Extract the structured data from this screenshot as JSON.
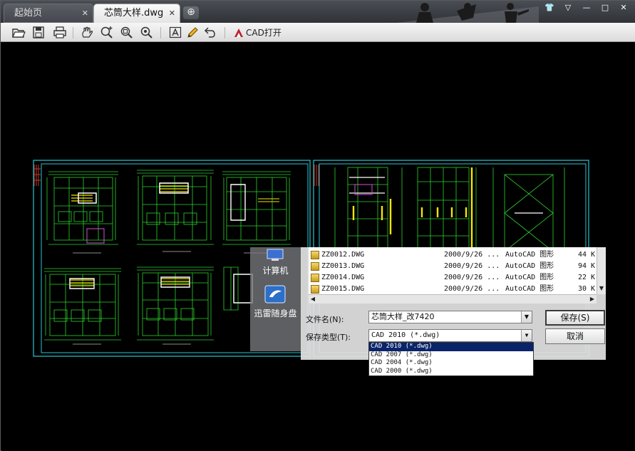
{
  "tabs": [
    {
      "label": "起始页",
      "active": false
    },
    {
      "label": "芯筒大样.dwg",
      "active": true
    }
  ],
  "toolbar": {
    "cad_open_label": "CAD打开"
  },
  "dialog": {
    "places": [
      {
        "label": "计算机",
        "icon": "computer-icon"
      },
      {
        "label": "迅雷随身盘",
        "icon": "cloud-drive-icon"
      }
    ],
    "files": [
      {
        "name": "ZZ0012.DWG",
        "date": "2000/9/26 ...",
        "type": "AutoCAD 图形",
        "size": "44 K"
      },
      {
        "name": "ZZ0013.DWG",
        "date": "2000/9/26 ...",
        "type": "AutoCAD 图形",
        "size": "94 K"
      },
      {
        "name": "ZZ0014.DWG",
        "date": "2000/9/26 ...",
        "type": "AutoCAD 图形",
        "size": "22 K"
      },
      {
        "name": "ZZ0015.DWG",
        "date": "2000/9/26 ...",
        "type": "AutoCAD 图形",
        "size": "30 K"
      }
    ],
    "filename_label": "文件名(N):",
    "filename_value": "芯筒大样_改7420",
    "filetype_label": "保存类型(T):",
    "filetype_value": "CAD 2010 (*.dwg)",
    "filetype_options": [
      "CAD 2010 (*.dwg)",
      "CAD 2007 (*.dwg)",
      "CAD 2004 (*.dwg)",
      "CAD 2000 (*.dwg)"
    ],
    "save_button": "保存(S)",
    "cancel_button": "取消"
  },
  "colors": {
    "cad_frame": "#29c6d2",
    "cad_green": "#2dd22d",
    "cad_yellow": "#f2e600",
    "selection": "#0a246a"
  }
}
